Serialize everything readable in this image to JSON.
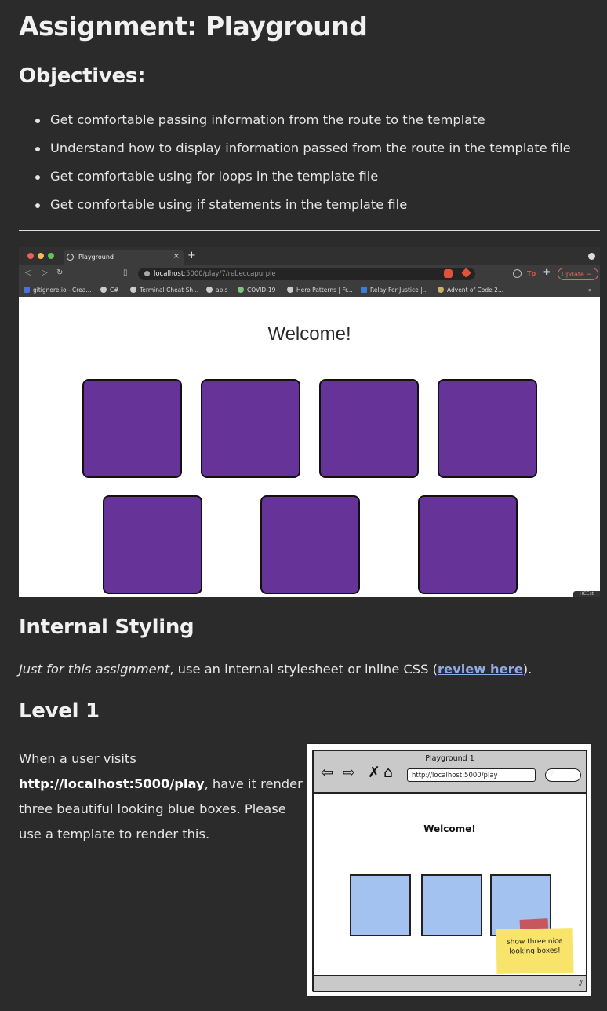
{
  "heading": "Assignment: Playground",
  "objectives": {
    "title": "Objectives:",
    "items": [
      "Get comfortable passing information from the route to the template",
      "Understand how to display information passed from the route in the template file",
      "Get comfortable using for loops in the template file",
      "Get comfortable using if statements in the template file"
    ]
  },
  "browser": {
    "tab_title": "Playground",
    "tab_close": "×",
    "new_tab": "+",
    "url_host": "localhost",
    "url_path": ":5000/play/7/rebeccapurple",
    "update_label": "Update",
    "update_menu_icon": "☰",
    "ext_tp": "Tp",
    "bookmarks": [
      "gitignore.io - Crea...",
      "C#",
      "Terminal Cheat Sh...",
      "apis",
      "COVID-19",
      "Hero Patterns | Fr...",
      "Relay For Justice |...",
      "Advent of Code 2..."
    ],
    "bookmarks_more": "»",
    "page_heading": "Welcome!",
    "box_color": "#663399",
    "box_count": 7,
    "corner_text": "HCEst"
  },
  "internal_styling": {
    "title": "Internal Styling",
    "emphasis": "Just for this assignment",
    "text_before_link": ", use an internal stylesheet or inline CSS (",
    "link_text": "review here",
    "text_after_link": ")."
  },
  "level1": {
    "title": "Level 1",
    "text_before": "When a user visits",
    "url": "http://localhost:5000/play",
    "text_after": ", have it render three beautiful looking blue boxes. Please use a template to render this."
  },
  "wireframe": {
    "window_title": "Playground 1",
    "url": "http://localhost:5000/play",
    "heading": "Welcome!",
    "box_color": "#a3c2f0",
    "box_count": 3,
    "note": "show three nice looking boxes!",
    "nav_icons": [
      "back-arrow-icon",
      "forward-arrow-icon",
      "stop-icon",
      "home-icon"
    ]
  }
}
